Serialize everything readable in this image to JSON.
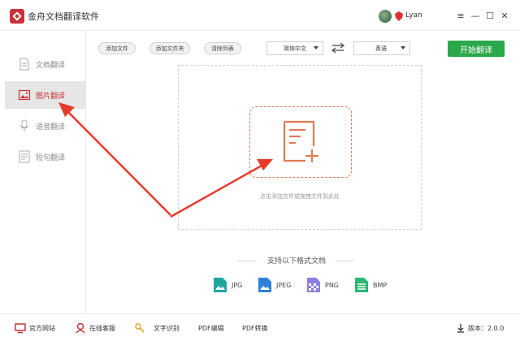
{
  "app": {
    "title": "金舟文档翻译软件"
  },
  "user": {
    "name": "Lyan"
  },
  "window_controls": {
    "menu": "≡",
    "minimize": "—",
    "maximize": "☐",
    "close": "✕"
  },
  "sidebar": {
    "items": [
      {
        "label": "文档翻译",
        "icon": "document-icon",
        "active": false
      },
      {
        "label": "图片翻译",
        "icon": "image-icon",
        "active": true
      },
      {
        "label": "语音翻译",
        "icon": "microphone-icon",
        "active": false
      },
      {
        "label": "短句翻译",
        "icon": "text-icon",
        "active": false
      }
    ]
  },
  "toolbar": {
    "add_file": "添加文件",
    "add_folder": "添加文件夹",
    "clear_list": "清除列表",
    "source_lang": "简体中文",
    "target_lang": "英语",
    "start": "开始翻译"
  },
  "drop": {
    "hint": "点击添加文件或拖拽文件到此处"
  },
  "formats": {
    "title": "支持以下格式文档",
    "items": [
      "JPG",
      "JPEG",
      "PNG",
      "BMP"
    ]
  },
  "bottom": {
    "website": "官方网站",
    "service": "在线客服",
    "ocr": "文字识别",
    "pdf_edit": "PDF编辑",
    "pdf_convert": "PDF转换",
    "version": "版本：2.0.0"
  },
  "colors": {
    "accent_green": "#2aa84a",
    "brand_red": "#c8323b",
    "annotation_red": "#e53a2c",
    "drop_border": "#e07a55"
  }
}
